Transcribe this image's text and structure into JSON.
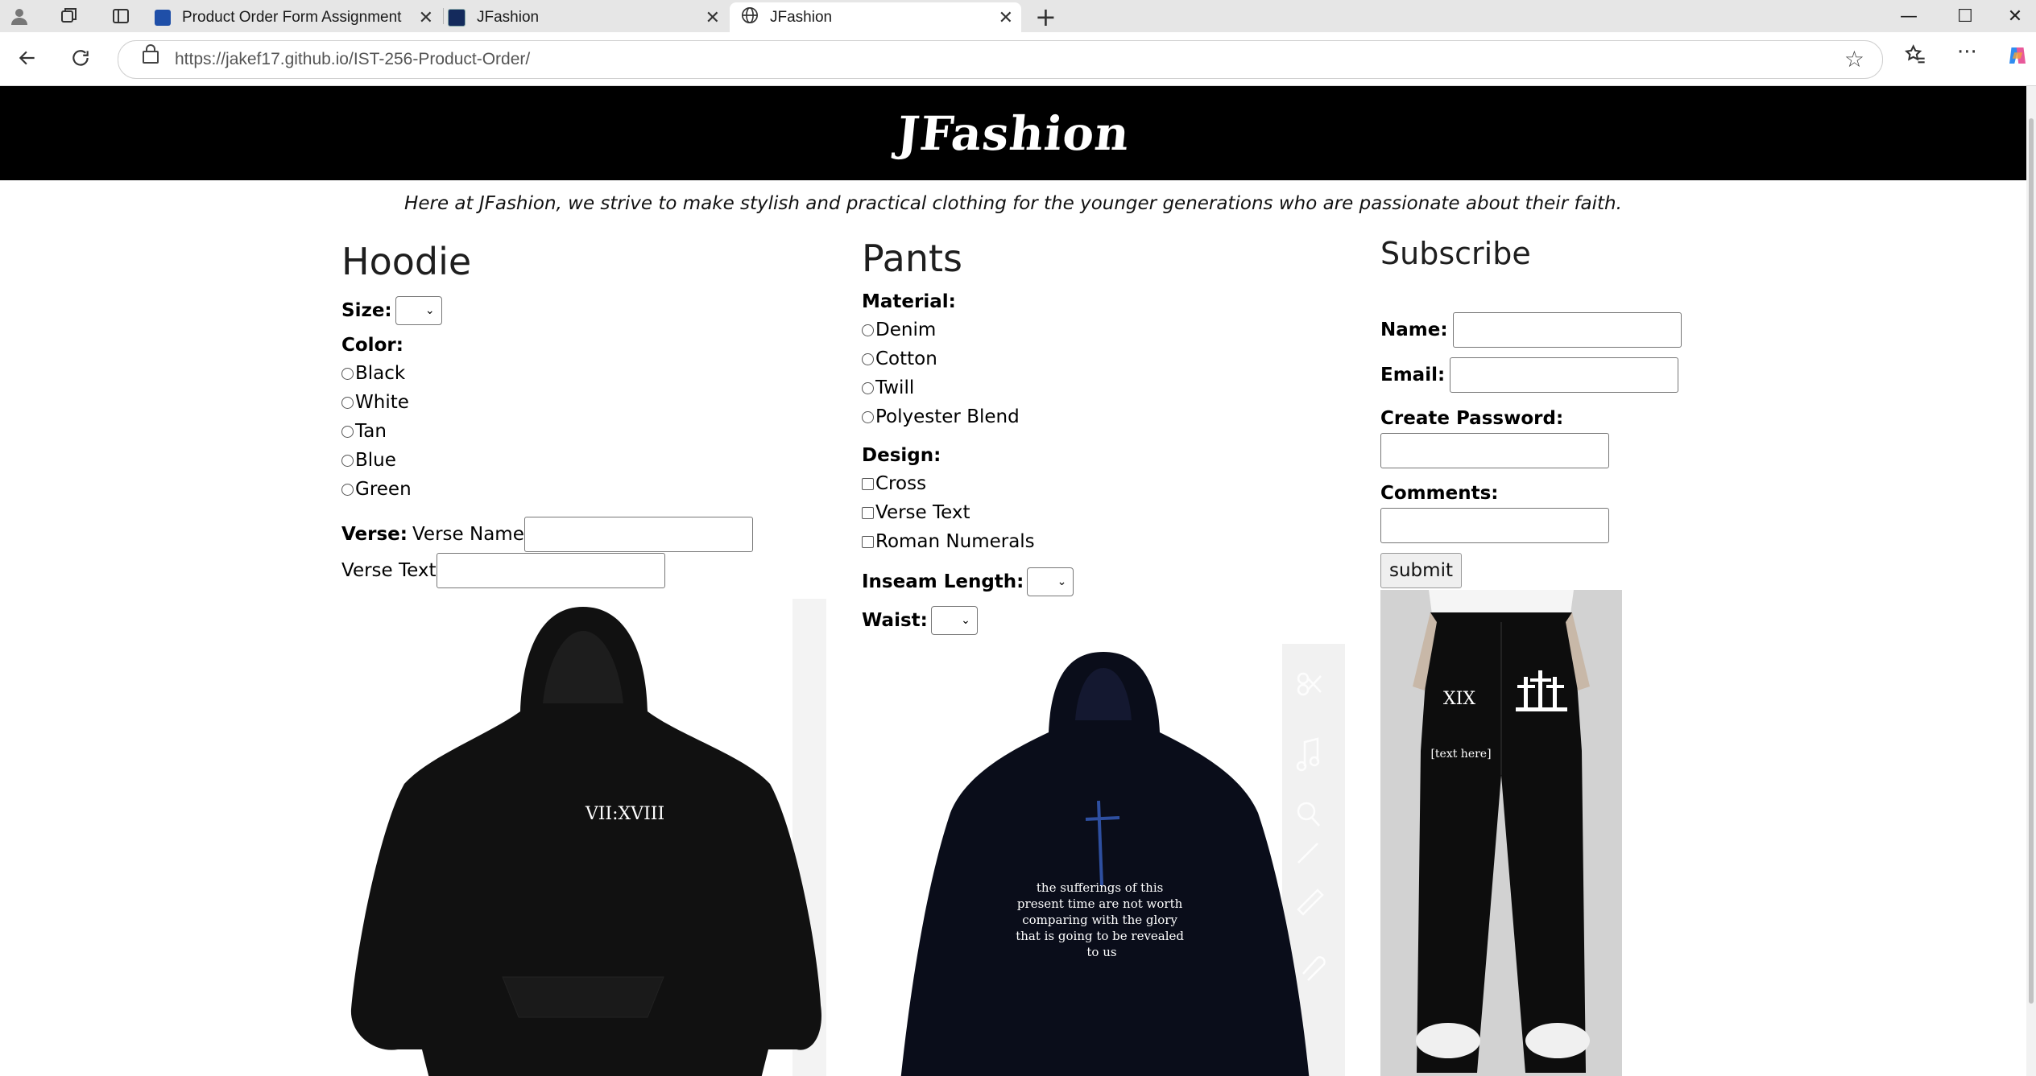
{
  "browser": {
    "tabs": [
      {
        "title": "Product Order Form Assignment"
      },
      {
        "title": "JFashion"
      },
      {
        "title": "JFashion"
      }
    ],
    "url_host": "https://jakef17.github.io",
    "url_path": "/IST-256-Product-Order/"
  },
  "page": {
    "brand": "JFashion",
    "tagline": "Here at JFashion, we strive to make stylish and practical clothing for the younger generations who are passionate about their faith.",
    "hoodie": {
      "title": "Hoodie",
      "size_label": "Size:",
      "color_label": "Color:",
      "colors": [
        "Black",
        "White",
        "Tan",
        "Blue",
        "Green"
      ],
      "verse_label": "Verse:",
      "verse_name_label": "Verse Name",
      "verse_text_label": "Verse Text",
      "image_text": "VII:XVIII"
    },
    "pants": {
      "title": "Pants",
      "material_label": "Material:",
      "materials": [
        "Denim",
        "Cotton",
        "Twill",
        "Polyester Blend"
      ],
      "design_label": "Design:",
      "designs": [
        "Cross",
        "Verse Text",
        "Roman Numerals"
      ],
      "inseam_label": "Inseam Length:",
      "waist_label": "Waist:",
      "image_text": "the sufferings of this present time are not worth comparing with the glory that is going to be revealed to us"
    },
    "subscribe": {
      "title": "Subscribe",
      "name_label": "Name:",
      "email_label": "Email:",
      "password_label": "Create Password:",
      "comments_label": "Comments:",
      "submit_label": "submit",
      "image_text_1": "XIX",
      "image_text_2": "[text here]"
    }
  }
}
